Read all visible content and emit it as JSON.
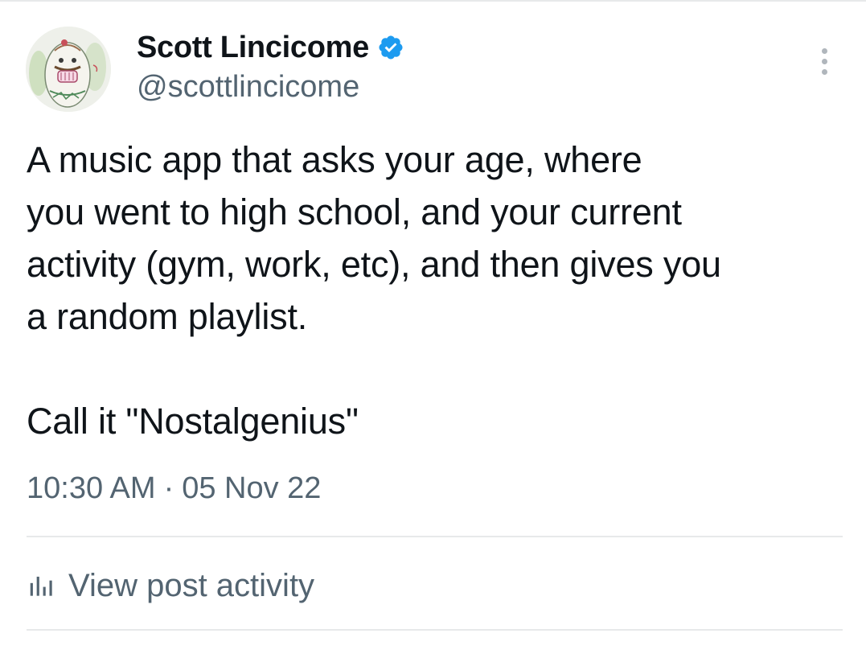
{
  "author": {
    "display_name": "Scott Lincicome",
    "handle": "@scottlincicome",
    "verified": true,
    "avatar_icon": "avatar-drawing-icon"
  },
  "post": {
    "text_lines": [
      "A music app that asks your age, where",
      "you went to high school, and your current",
      "activity (gym, work, etc), and then gives you",
      "a random playlist."
    ],
    "text_final": "Call it \"Nostalgenius\""
  },
  "meta": {
    "time": "10:30 AM",
    "separator": "·",
    "date": "05 Nov 22"
  },
  "activity": {
    "label": "View post activity",
    "icon": "bar-chart-icon"
  },
  "colors": {
    "text_primary": "#0f1419",
    "text_secondary": "#536471",
    "verified_blue": "#1d9bf0",
    "divider": "#e7e9ea"
  }
}
